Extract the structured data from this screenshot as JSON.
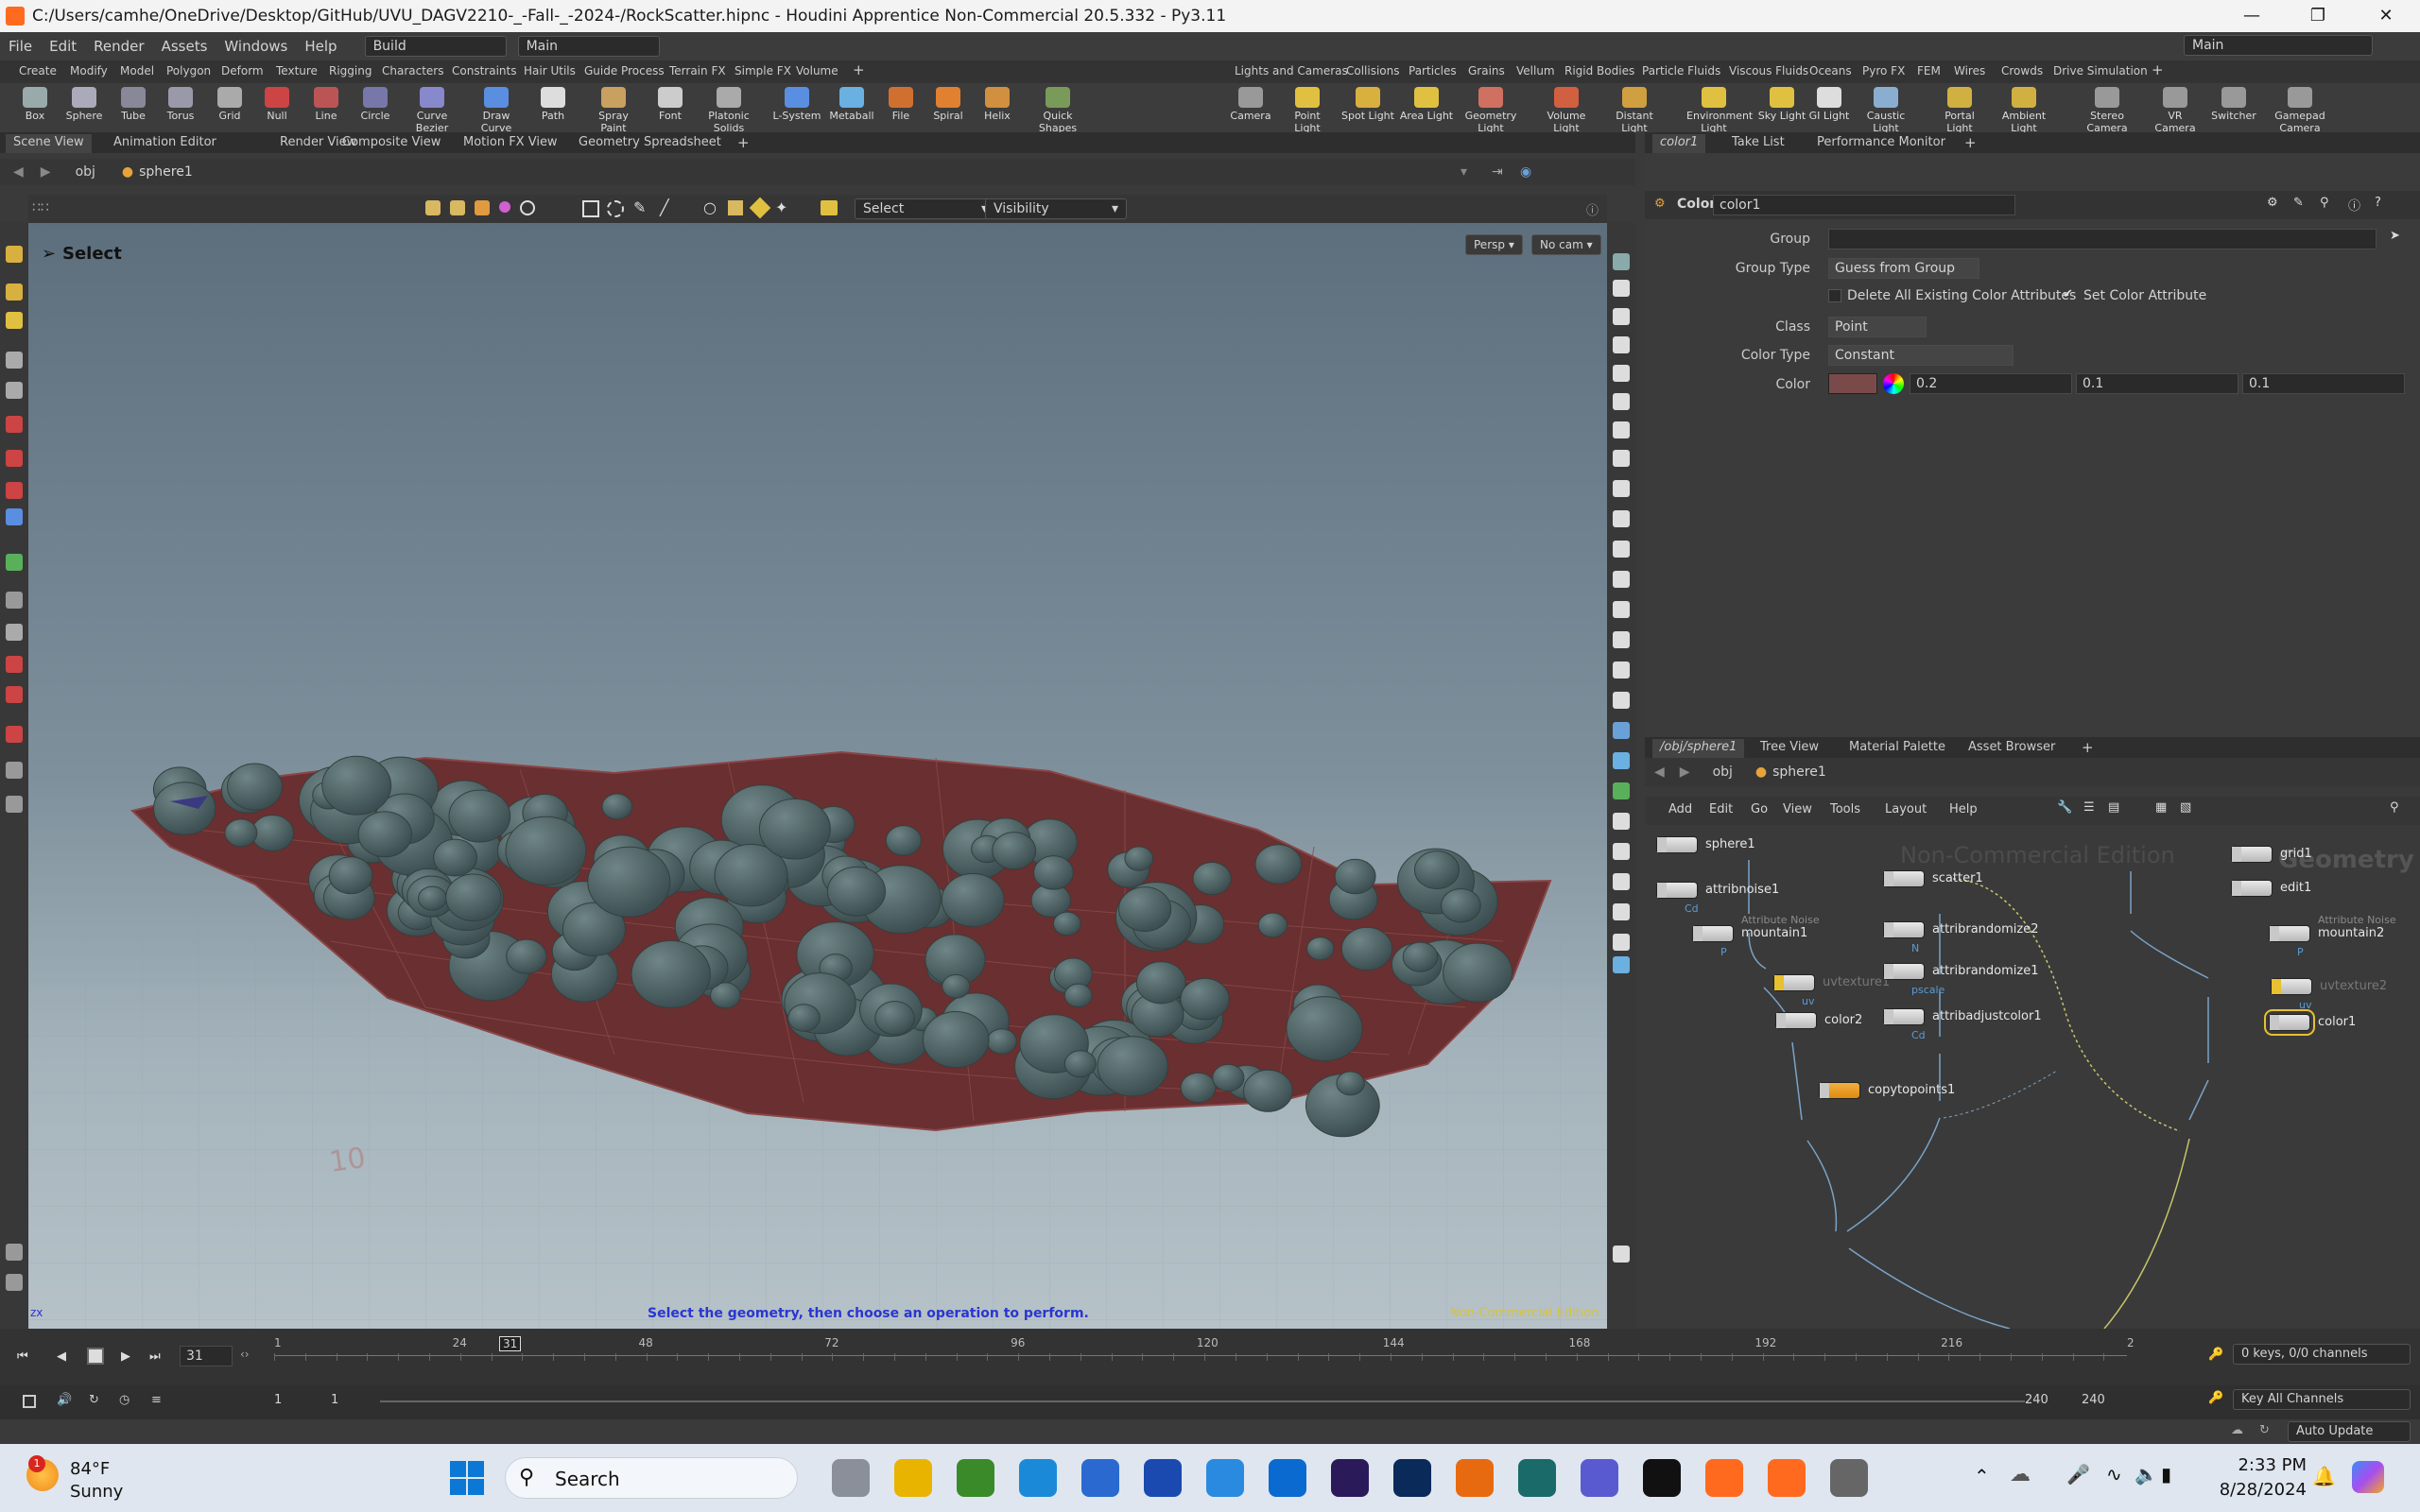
{
  "window": {
    "title": "C:/Users/camhe/OneDrive/Desktop/GitHub/UVU_DAGV2210-_-Fall-_-2024-/RockScatter.hipnc - Houdini Apprentice Non-Commercial 20.5.332 - Py3.11"
  },
  "menu": {
    "items": [
      "File",
      "Edit",
      "Render",
      "Assets",
      "Windows",
      "Help"
    ],
    "desktop": "Build",
    "network": "Main",
    "right_desktop": "Main"
  },
  "shelf_tabs_left": [
    "Create",
    "Modify",
    "Model",
    "Polygon",
    "Deform",
    "Texture",
    "Rigging",
    "Characters",
    "Constraints",
    "Hair Utils",
    "Guide Process",
    "Terrain FX",
    "Simple FX",
    "Volume"
  ],
  "shelf_tabs_right": [
    "Lights and Cameras",
    "Collisions",
    "Particles",
    "Grains",
    "Vellum",
    "Rigid Bodies",
    "Particle Fluids",
    "Viscous Fluids",
    "Oceans",
    "Pyro FX",
    "FEM",
    "Wires",
    "Crowds",
    "Drive Simulation"
  ],
  "shelf_tools_left": [
    "Box",
    "Sphere",
    "Tube",
    "Torus",
    "Grid",
    "Null",
    "Line",
    "Circle",
    "Curve Bezier",
    "Draw Curve",
    "Path",
    "Spray Paint",
    "Font",
    "Platonic Solids",
    "L-System",
    "Metaball",
    "File",
    "Spiral",
    "Helix",
    "Quick Shapes"
  ],
  "shelf_tools_right": [
    "Camera",
    "Point Light",
    "Spot Light",
    "Area Light",
    "Geometry Light",
    "Volume Light",
    "Distant Light",
    "Environment Light",
    "Sky Light",
    "GI Light",
    "Caustic Light",
    "Portal Light",
    "Ambient Light",
    "Stereo Camera",
    "VR Camera",
    "Switcher",
    "Gamepad Camera"
  ],
  "pane_tabs_left": [
    "Scene View",
    "Animation Editor",
    "Render View",
    "Composite View",
    "Motion FX View",
    "Geometry Spreadsheet"
  ],
  "path": {
    "obj": "obj",
    "node": "sphere1"
  },
  "viewport": {
    "select_dd": "Select",
    "visibility_dd": "Visibility",
    "mode_label": "Select",
    "persp": "Persp",
    "cam": "No cam",
    "hint": "Select the geometry, then choose an operation to perform.",
    "watermark": "Non-Commercial Edition",
    "axis": "zx"
  },
  "param": {
    "tabs": [
      "color1",
      "Take List",
      "Performance Monitor"
    ],
    "node_type": "Color",
    "node_name": "color1",
    "group_label": "Group",
    "group_value": "",
    "group_type_label": "Group Type",
    "group_type_value": "Guess from Group",
    "delete_label": "Delete All Existing Color Attributes",
    "set_label": "Set Color Attribute",
    "class_label": "Class",
    "class_value": "Point",
    "color_type_label": "Color Type",
    "color_type_value": "Constant",
    "color_label": "Color",
    "color_r": "0.2",
    "color_g": "0.1",
    "color_b": "0.1",
    "swatch": "#7a4a4a"
  },
  "network": {
    "tabs": [
      "/obj/sphere1",
      "Tree View",
      "Material Palette",
      "Asset Browser"
    ],
    "menu": [
      "Add",
      "Edit",
      "Go",
      "View",
      "Tools",
      "Layout",
      "Help"
    ],
    "watermark": "Non-Commercial Edition",
    "context": "Geometry",
    "nodes": [
      {
        "name": "sphere1"
      },
      {
        "name": "attribnoise1",
        "sub": "Cd"
      },
      {
        "name": "mountain1",
        "comment": "Attribute Noise",
        "sub": "P"
      },
      {
        "name": "uvtexture1",
        "sub": "uv"
      },
      {
        "name": "color2"
      },
      {
        "name": "scatter1"
      },
      {
        "name": "attribrandomize2",
        "sub": "N"
      },
      {
        "name": "attribrandomize1",
        "sub": "pscale"
      },
      {
        "name": "attribadjustcolor1",
        "sub": "Cd"
      },
      {
        "name": "copytopoints1"
      },
      {
        "name": "grid1"
      },
      {
        "name": "edit1"
      },
      {
        "name": "mountain2",
        "comment": "Attribute Noise",
        "sub": "P"
      },
      {
        "name": "uvtexture2",
        "sub": "uv"
      },
      {
        "name": "color1"
      }
    ]
  },
  "timeline": {
    "current": "31",
    "ticks": [
      "1",
      "24",
      "48",
      "72",
      "96",
      "120",
      "144",
      "168",
      "192",
      "216",
      "2"
    ],
    "start": "1",
    "start2": "1",
    "end": "240",
    "end2": "240",
    "keys": "0 keys, 0/0 channels",
    "key_all": "Key All Channels",
    "auto_update": "Auto Update"
  },
  "taskbar": {
    "temp": "84°F",
    "weather": "Sunny",
    "search": "Search",
    "time": "2:33 PM",
    "date": "8/28/2024",
    "badge": "1"
  }
}
